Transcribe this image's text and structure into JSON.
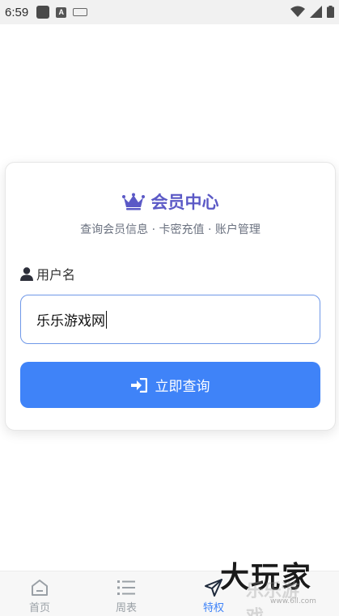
{
  "status_bar": {
    "time": "6:59",
    "notification_a": "A"
  },
  "card": {
    "title": "会员中心",
    "subtitle": "查询会员信息 · 卡密充值 · 账户管理",
    "username_label": "用户名",
    "username_value": "乐乐游戏网",
    "submit_label": "立即查询"
  },
  "nav": {
    "items": [
      {
        "label": "首页",
        "active": false
      },
      {
        "label": "周表",
        "active": false
      },
      {
        "label": "特权",
        "active": true
      }
    ]
  },
  "watermark": {
    "text": "大玩家",
    "ghost": "乐乐游戏",
    "url": "www.6ll.com"
  },
  "colors": {
    "accent": "#3f83f8",
    "title": "#5b59c6",
    "inactive": "#9aa0a6"
  }
}
